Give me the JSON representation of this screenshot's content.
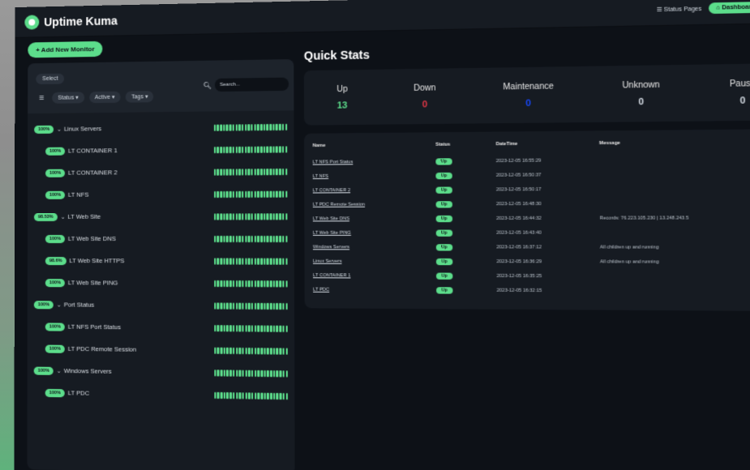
{
  "app": {
    "title": "Uptime Kuma",
    "status_pages": "Status Pages",
    "dashboard": "Dashboard"
  },
  "sidebar": {
    "add_button": "+ Add New Monitor",
    "select": "Select",
    "search_placeholder": "Search...",
    "filters": {
      "status": "Status",
      "active": "Active",
      "tags": "Tags"
    },
    "monitors": [
      {
        "pct": "100%",
        "name": "Linux Servers",
        "group": true
      },
      {
        "pct": "100%",
        "name": "LT CONTAINER 1",
        "group": false
      },
      {
        "pct": "100%",
        "name": "LT CONTAINER 2",
        "group": false
      },
      {
        "pct": "100%",
        "name": "LT NFS",
        "group": false
      },
      {
        "pct": "98.53%",
        "name": "LT Web Site",
        "group": true
      },
      {
        "pct": "100%",
        "name": "LT Web Site DNS",
        "group": false
      },
      {
        "pct": "98.6%",
        "name": "LT Web Site HTTPS",
        "group": false
      },
      {
        "pct": "100%",
        "name": "LT Web Site PING",
        "group": false
      },
      {
        "pct": "100%",
        "name": "Port Status",
        "group": true
      },
      {
        "pct": "100%",
        "name": "LT NFS Port Status",
        "group": false
      },
      {
        "pct": "100%",
        "name": "LT PDC Remote Session",
        "group": false
      },
      {
        "pct": "100%",
        "name": "Windows Servers",
        "group": true
      },
      {
        "pct": "100%",
        "name": "LT PDC",
        "group": false
      }
    ]
  },
  "quick_stats": {
    "title": "Quick Stats",
    "up": {
      "label": "Up",
      "value": "13"
    },
    "down": {
      "label": "Down",
      "value": "0"
    },
    "maintenance": {
      "label": "Maintenance",
      "value": "0"
    },
    "unknown": {
      "label": "Unknown",
      "value": "0"
    },
    "pause": {
      "label": "Pause",
      "value": "0"
    }
  },
  "events": {
    "headers": [
      "Name",
      "Status",
      "DateTime",
      "Message"
    ],
    "rows": [
      {
        "name": "LT NFS Port Status",
        "status": "Up",
        "datetime": "2023-12-05 16:55:29",
        "message": ""
      },
      {
        "name": "LT NFS",
        "status": "Up",
        "datetime": "2023-12-05 16:50:37",
        "message": ""
      },
      {
        "name": "LT CONTAINER 2",
        "status": "Up",
        "datetime": "2023-12-05 16:50:17",
        "message": ""
      },
      {
        "name": "LT PDC Remote Session",
        "status": "Up",
        "datetime": "2023-12-05 16:48:30",
        "message": ""
      },
      {
        "name": "LT Web Site DNS",
        "status": "Up",
        "datetime": "2023-12-05 16:44:32",
        "message": "Records: 76.223.105.230 | 13.248.243.5"
      },
      {
        "name": "LT Web Site PING",
        "status": "Up",
        "datetime": "2023-12-05 16:43:40",
        "message": ""
      },
      {
        "name": "Windows Servers",
        "status": "Up",
        "datetime": "2023-12-05 16:37:12",
        "message": "All children up and running"
      },
      {
        "name": "Linux Servers",
        "status": "Up",
        "datetime": "2023-12-05 16:36:29",
        "message": "All children up and running"
      },
      {
        "name": "LT CONTAINER 1",
        "status": "Up",
        "datetime": "2023-12-05 16:35:25",
        "message": ""
      },
      {
        "name": "LT PDC",
        "status": "Up",
        "datetime": "2023-12-05 16:32:15",
        "message": ""
      }
    ]
  },
  "colors": {
    "accent": "#5cdd8b",
    "down": "#dc3545",
    "maintenance": "#1747f5",
    "bg": "#0d1117",
    "panel": "#161b22"
  }
}
